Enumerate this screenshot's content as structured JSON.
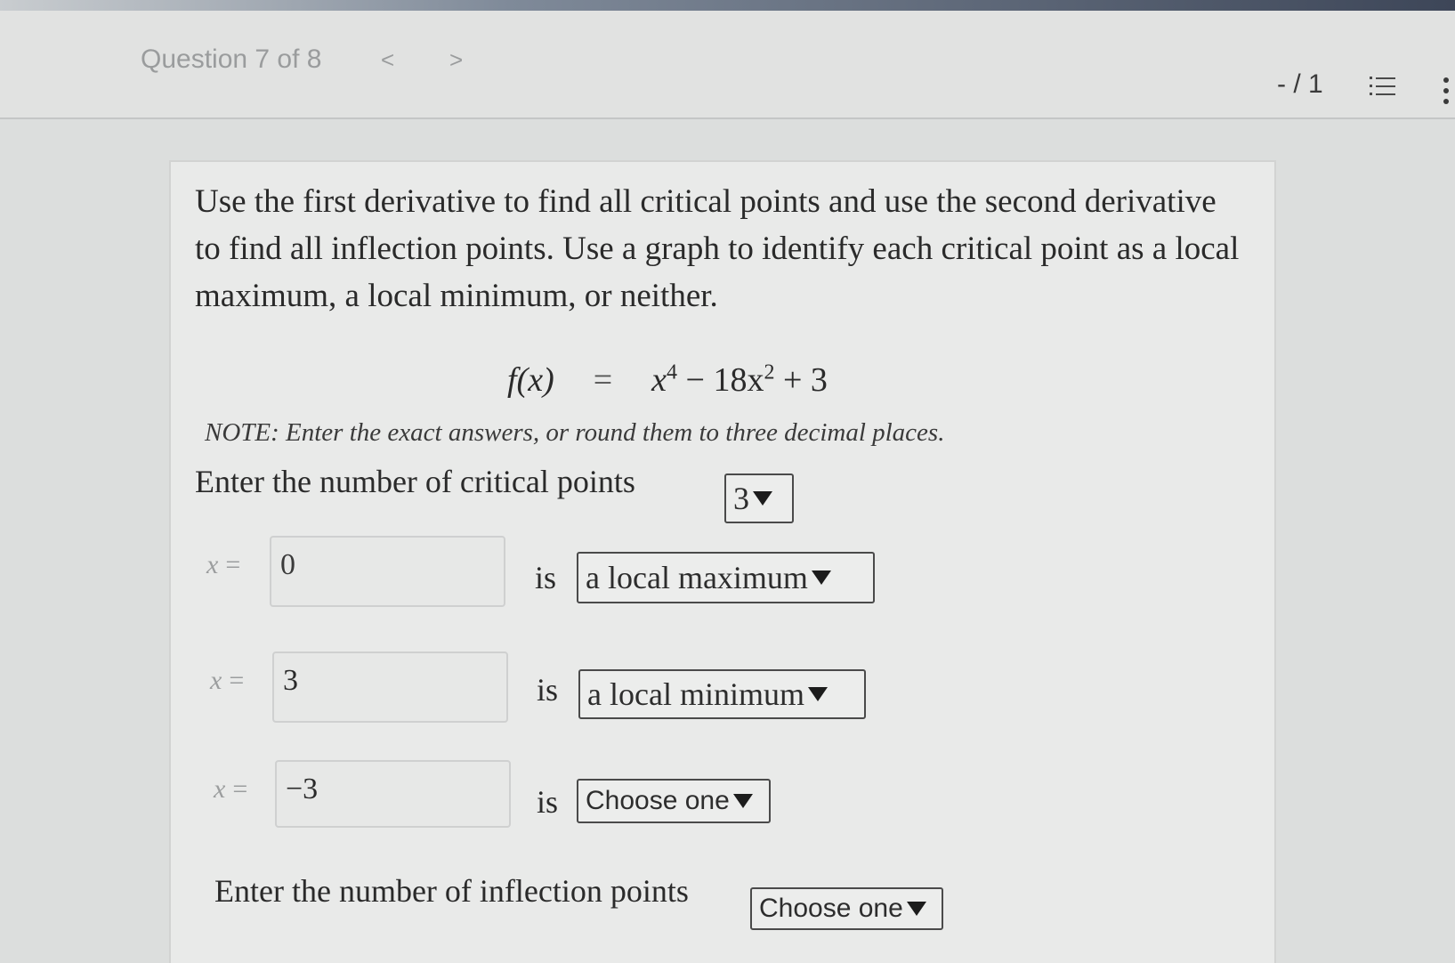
{
  "header": {
    "question_label": "Question 7 of 8",
    "prev_glyph": "<",
    "next_glyph": ">",
    "score": "- / 1",
    "list_icon": "list-icon",
    "more_icon": "more-vertical-icon"
  },
  "problem": {
    "prompt": "Use the first derivative to find all critical points and use the second derivative to find all inflection points. Use a graph to identify each critical point as a local maximum, a local minimum, or neither.",
    "formula": {
      "lhs": "f(x)",
      "equals": "=",
      "rhs_term1_base": "x",
      "rhs_term1_exp": "4",
      "rhs_middle": " − 18x",
      "rhs_term2_exp": "2",
      "rhs_tail": " + 3"
    },
    "note": "NOTE: Enter the exact answers, or round them to three decimal places.",
    "critical_count_label": "Enter the number of critical points",
    "critical_count_value": "3",
    "critical_points": [
      {
        "var_label": "x",
        "eq": "=",
        "value": "0",
        "is_label": "is",
        "classification": "a local maximum"
      },
      {
        "var_label": "x",
        "eq": "=",
        "value": "3",
        "is_label": "is",
        "classification": "a local minimum"
      },
      {
        "var_label": "x",
        "eq": "=",
        "value": "−3",
        "is_label": "is",
        "classification": "Choose one"
      }
    ],
    "inflection_count_label": "Enter the number of inflection points",
    "inflection_count_value": "Choose one"
  }
}
